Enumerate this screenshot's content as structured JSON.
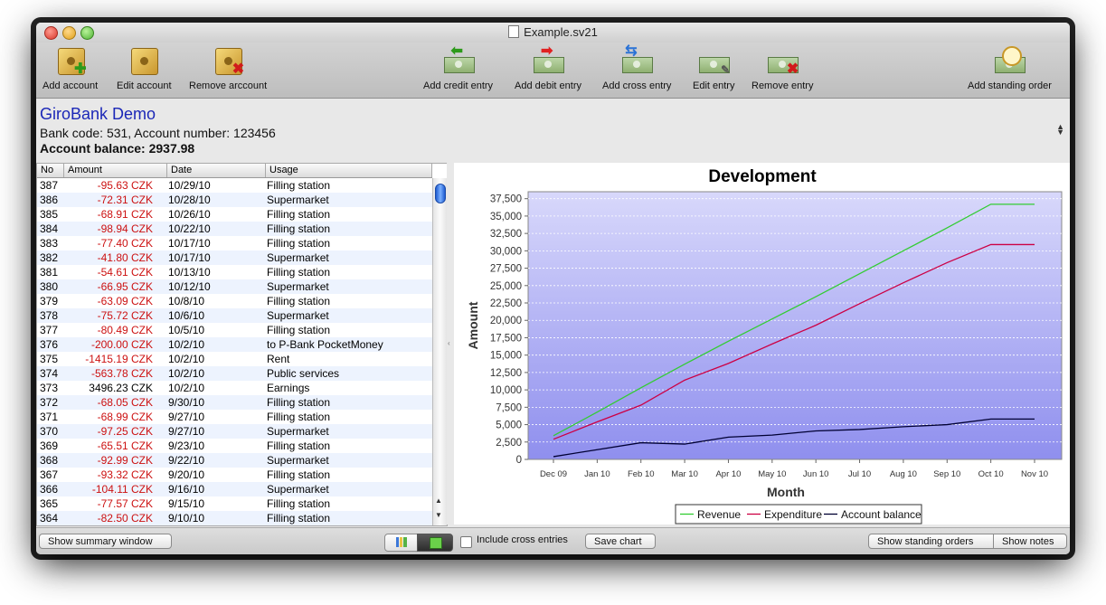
{
  "window": {
    "title": "Example.sv21"
  },
  "toolbar": {
    "add_account": "Add account",
    "edit_account": "Edit account",
    "remove_account": "Remove arccount",
    "add_credit": "Add credit entry",
    "add_debit": "Add debit entry",
    "add_cross": "Add cross entry",
    "edit_entry": "Edit entry",
    "remove_entry": "Remove entry",
    "add_standing": "Add standing order"
  },
  "account": {
    "name": "GiroBank Demo",
    "bank_line": "Bank code: 531, Account number: 123456",
    "balance_label": "Account balance:",
    "balance_value": "2937.98"
  },
  "table": {
    "headers": [
      "No",
      "Amount",
      "Date",
      "Usage"
    ],
    "rows": [
      {
        "no": "387",
        "amount": "-95.63 CZK",
        "date": "10/29/10",
        "usage": "Filling station"
      },
      {
        "no": "386",
        "amount": "-72.31 CZK",
        "date": "10/28/10",
        "usage": "Supermarket"
      },
      {
        "no": "385",
        "amount": "-68.91 CZK",
        "date": "10/26/10",
        "usage": "Filling station"
      },
      {
        "no": "384",
        "amount": "-98.94 CZK",
        "date": "10/22/10",
        "usage": "Filling station"
      },
      {
        "no": "383",
        "amount": "-77.40 CZK",
        "date": "10/17/10",
        "usage": "Filling station"
      },
      {
        "no": "382",
        "amount": "-41.80 CZK",
        "date": "10/17/10",
        "usage": "Supermarket"
      },
      {
        "no": "381",
        "amount": "-54.61 CZK",
        "date": "10/13/10",
        "usage": "Filling station"
      },
      {
        "no": "380",
        "amount": "-66.95 CZK",
        "date": "10/12/10",
        "usage": "Supermarket"
      },
      {
        "no": "379",
        "amount": "-63.09 CZK",
        "date": "10/8/10",
        "usage": "Filling station"
      },
      {
        "no": "378",
        "amount": "-75.72 CZK",
        "date": "10/6/10",
        "usage": "Supermarket"
      },
      {
        "no": "377",
        "amount": "-80.49 CZK",
        "date": "10/5/10",
        "usage": "Filling station"
      },
      {
        "no": "376",
        "amount": "-200.00 CZK",
        "date": "10/2/10",
        "usage": "to P-Bank PocketMoney"
      },
      {
        "no": "375",
        "amount": "-1415.19 CZK",
        "date": "10/2/10",
        "usage": "Rent"
      },
      {
        "no": "374",
        "amount": "-563.78 CZK",
        "date": "10/2/10",
        "usage": "Public services"
      },
      {
        "no": "373",
        "amount": "3496.23 CZK",
        "date": "10/2/10",
        "usage": "Earnings"
      },
      {
        "no": "372",
        "amount": "-68.05 CZK",
        "date": "9/30/10",
        "usage": "Filling station"
      },
      {
        "no": "371",
        "amount": "-68.99 CZK",
        "date": "9/27/10",
        "usage": "Filling station"
      },
      {
        "no": "370",
        "amount": "-97.25 CZK",
        "date": "9/27/10",
        "usage": "Supermarket"
      },
      {
        "no": "369",
        "amount": "-65.51 CZK",
        "date": "9/23/10",
        "usage": "Filling station"
      },
      {
        "no": "368",
        "amount": "-92.99 CZK",
        "date": "9/22/10",
        "usage": "Supermarket"
      },
      {
        "no": "367",
        "amount": "-93.32 CZK",
        "date": "9/20/10",
        "usage": "Filling station"
      },
      {
        "no": "366",
        "amount": "-104.11 CZK",
        "date": "9/16/10",
        "usage": "Supermarket"
      },
      {
        "no": "365",
        "amount": "-77.57 CZK",
        "date": "9/15/10",
        "usage": "Filling station"
      },
      {
        "no": "364",
        "amount": "-82.50 CZK",
        "date": "9/10/10",
        "usage": "Filling station"
      }
    ]
  },
  "bottom": {
    "summary": "Show summary window",
    "include_cross": "Include cross entries",
    "save_chart": "Save chart",
    "standing_orders": "Show standing orders",
    "notes": "Show notes"
  },
  "colors": {
    "revenue": "#33cc33",
    "expenditure": "#cc0044",
    "balance": "#000033",
    "negative": "#cc1111",
    "plot_top": "#d8d8fb",
    "plot_bottom": "#8f8fee"
  },
  "chart_data": {
    "type": "line",
    "title": "Development",
    "xlabel": "Month",
    "ylabel": "Amount",
    "categories": [
      "Dec 09",
      "Jan 10",
      "Feb 10",
      "Mar 10",
      "Apr 10",
      "May 10",
      "Jun 10",
      "Jul 10",
      "Aug 10",
      "Sep 10",
      "Oct 10",
      "Nov 10"
    ],
    "yticks": [
      "0",
      "2,500",
      "5,000",
      "7,500",
      "10,000",
      "12,500",
      "15,000",
      "17,500",
      "20,000",
      "22,500",
      "25,000",
      "27,500",
      "30,000",
      "32,500",
      "35,000",
      "37,500"
    ],
    "ylim": [
      0,
      38500
    ],
    "grid": true,
    "legend_position": "bottom",
    "series": [
      {
        "name": "Revenue",
        "values": [
          3400,
          6800,
          10300,
          13700,
          17000,
          20200,
          23400,
          26700,
          30000,
          33300,
          36700,
          36700
        ]
      },
      {
        "name": "Expenditure",
        "values": [
          2900,
          5400,
          7800,
          11400,
          13800,
          16600,
          19300,
          22400,
          25400,
          28300,
          30900,
          30900
        ]
      },
      {
        "name": "Account balance",
        "values": [
          400,
          1400,
          2400,
          2200,
          3200,
          3500,
          4100,
          4300,
          4700,
          5000,
          5800,
          5800
        ]
      }
    ]
  }
}
